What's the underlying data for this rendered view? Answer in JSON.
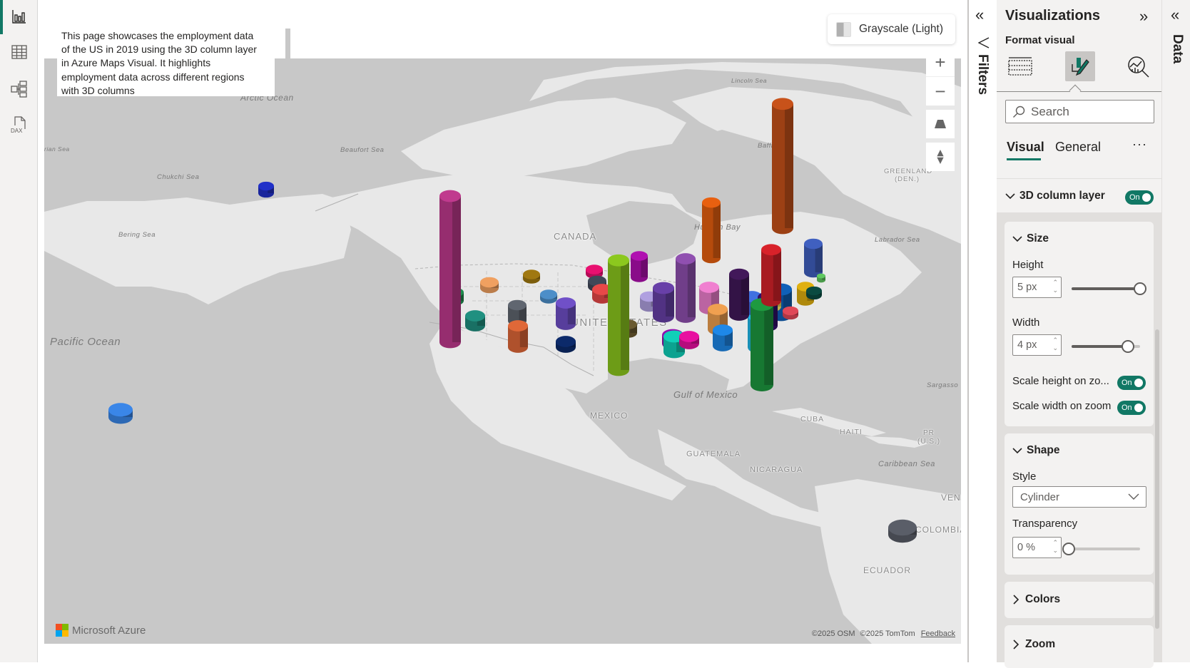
{
  "left_nav": {
    "items": [
      {
        "name": "report-view",
        "icon": "bar-chart-icon",
        "active": true
      },
      {
        "name": "table-view",
        "icon": "table-grid-icon",
        "active": false
      },
      {
        "name": "model-view",
        "icon": "model-diagram-icon",
        "active": false
      },
      {
        "name": "dax-query-view",
        "icon": "dax-file-icon",
        "active": false,
        "label": "DAX"
      }
    ]
  },
  "canvas": {
    "description": "This page showcases the employment data of the US in 2019 using the 3D column layer in Azure Maps Visual. It highlights employment data across different regions with 3D columns",
    "map_style_button": "Grayscale (Light)",
    "map_controls": {
      "zoom_in": "+",
      "zoom_out": "−",
      "pitch": "pitch-icon",
      "compass": "compass-icon"
    },
    "labels": {
      "oceans": [
        "Arctic Ocean",
        "Pacific Ocean"
      ],
      "seas": [
        "Chukchi Sea",
        "Beaufort Sea",
        "Bering Sea",
        "Lincoln Sea",
        "Baffin Bay",
        "Hudson Bay",
        "Labrador Sea",
        "Gulf of Mexico",
        "Sargasso",
        "Caribbean Sea",
        "rian Sea"
      ],
      "countries": [
        "CANADA",
        "UNITED STATES",
        "MEXICO",
        "CUBA",
        "HAITI",
        "PR",
        "(U.S.)",
        "GUATEMALA",
        "NICARAGUA",
        "COLOMBIA",
        "ECUADOR",
        "VENI",
        "GREENLAND",
        "(DEN.)"
      ]
    },
    "brand": "Microsoft Azure",
    "attribution": {
      "osm": "©2025 OSM",
      "tomtom": "©2025 TomTom",
      "feedback": "Feedback"
    },
    "columns": [
      {
        "region": "Alaska",
        "color": "#2030c8",
        "level": 0.02
      },
      {
        "region": "Hawaii",
        "color": "#3a86e8",
        "level": 0.05
      },
      {
        "region": "California",
        "color": "#c03a8e",
        "level": 1.0
      },
      {
        "region": "Texas",
        "color": "#8cc81e",
        "level": 0.75
      },
      {
        "region": "New York",
        "color": "#c8521a",
        "level": 0.85
      },
      {
        "region": "Florida",
        "color": "#1e9a40",
        "level": 0.55
      },
      {
        "region": "Pennsylvania",
        "color": "#d8222a",
        "level": 0.35
      },
      {
        "region": "Illinois",
        "color": "#9050b0",
        "level": 0.4
      },
      {
        "region": "Ohio",
        "color": "#42185a",
        "level": 0.28
      },
      {
        "region": "Michigan",
        "color": "#e86010",
        "level": 0.38
      },
      {
        "region": "Colombia",
        "color": "#5a5e68",
        "level": 0.03
      }
    ]
  },
  "filters_pane": {
    "title": "Filters",
    "collapse": "«"
  },
  "visualizations": {
    "title": "Visualizations",
    "collapse": "»",
    "subtitle": "Format visual",
    "format_icons": [
      "build-visual-icon",
      "format-visual-icon",
      "analytics-icon"
    ],
    "search_placeholder": "Search",
    "tabs": [
      {
        "label": "Visual",
        "active": true
      },
      {
        "label": "General",
        "active": false
      }
    ],
    "more": "···",
    "layer": {
      "label": "3D column layer",
      "toggle": "On"
    },
    "size": {
      "label": "Size",
      "height_label": "Height",
      "height_value": "5 px",
      "height_slider": 1.0,
      "width_label": "Width",
      "width_value": "4 px",
      "width_slider": 0.82,
      "scale_height_label": "Scale height on zo...",
      "scale_height_toggle": "On",
      "scale_width_label": "Scale width on zoom",
      "scale_width_toggle": "On"
    },
    "shape": {
      "label": "Shape",
      "style_label": "Style",
      "style_value": "Cylinder",
      "transparency_label": "Transparency",
      "transparency_value": "0 %",
      "transparency_slider": 0.0
    },
    "colors": {
      "label": "Colors"
    },
    "zoom": {
      "label": "Zoom"
    }
  },
  "data_pane": {
    "title": "Data",
    "collapse": "«"
  }
}
